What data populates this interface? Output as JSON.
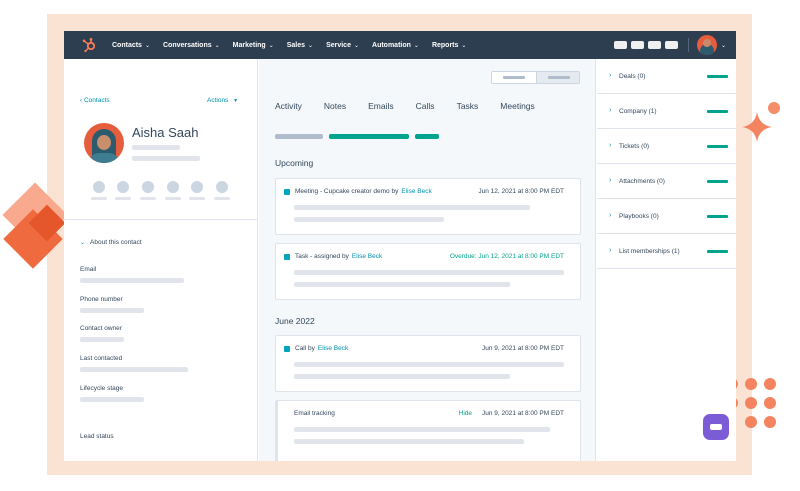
{
  "nav": {
    "items": [
      {
        "label": "Contacts"
      },
      {
        "label": "Conversations"
      },
      {
        "label": "Marketing"
      },
      {
        "label": "Sales"
      },
      {
        "label": "Service"
      },
      {
        "label": "Automation"
      },
      {
        "label": "Reports"
      }
    ]
  },
  "left": {
    "back_label": "Contacts",
    "actions_label": "Actions",
    "contact_name": "Aisha Saah",
    "about_label": "About this contact",
    "fields": [
      {
        "label": "Email"
      },
      {
        "label": "Phone number"
      },
      {
        "label": "Contact owner"
      },
      {
        "label": "Last contacted"
      },
      {
        "label": "Lifecycle stage"
      },
      {
        "label": "Lead status"
      }
    ]
  },
  "main": {
    "tabs": [
      {
        "label": "Activity"
      },
      {
        "label": "Notes"
      },
      {
        "label": "Emails"
      },
      {
        "label": "Calls"
      },
      {
        "label": "Tasks"
      },
      {
        "label": "Meetings"
      }
    ],
    "sections": {
      "upcoming": "Upcoming",
      "june": "June 2022"
    },
    "cards": [
      {
        "title": "Meeting - Cupcake creator demo",
        "by_prefix": "by",
        "by": "Elise Beck",
        "date": "Jun 12, 2021 at 8:00 PM EDT"
      },
      {
        "title": "Task - assigned",
        "by_prefix": "by",
        "by": "Elise Beck",
        "overdue": "Overdue: Jun 12, 2021 at 8:00 PM EDT"
      },
      {
        "title": "Call",
        "by_prefix": "by",
        "by": "Elise Beck",
        "date": "Jun 9, 2021 at 8:00 PM EDT"
      },
      {
        "title": "Email tracking",
        "hide": "Hide",
        "date": "Jun 9, 2021 at 8:00 PM EDT"
      }
    ]
  },
  "right": {
    "items": [
      {
        "label": "Deals (0)"
      },
      {
        "label": "Company (1)"
      },
      {
        "label": "Tickets (0)"
      },
      {
        "label": "Attachments (0)"
      },
      {
        "label": "Playbooks (0)"
      },
      {
        "label": "List memberships (1)"
      }
    ]
  },
  "colors": {
    "nav_bg": "#2d3e50",
    "accent_teal": "#00a38d",
    "link_blue": "#0091ae",
    "brand_orange": "#ff7a59"
  }
}
